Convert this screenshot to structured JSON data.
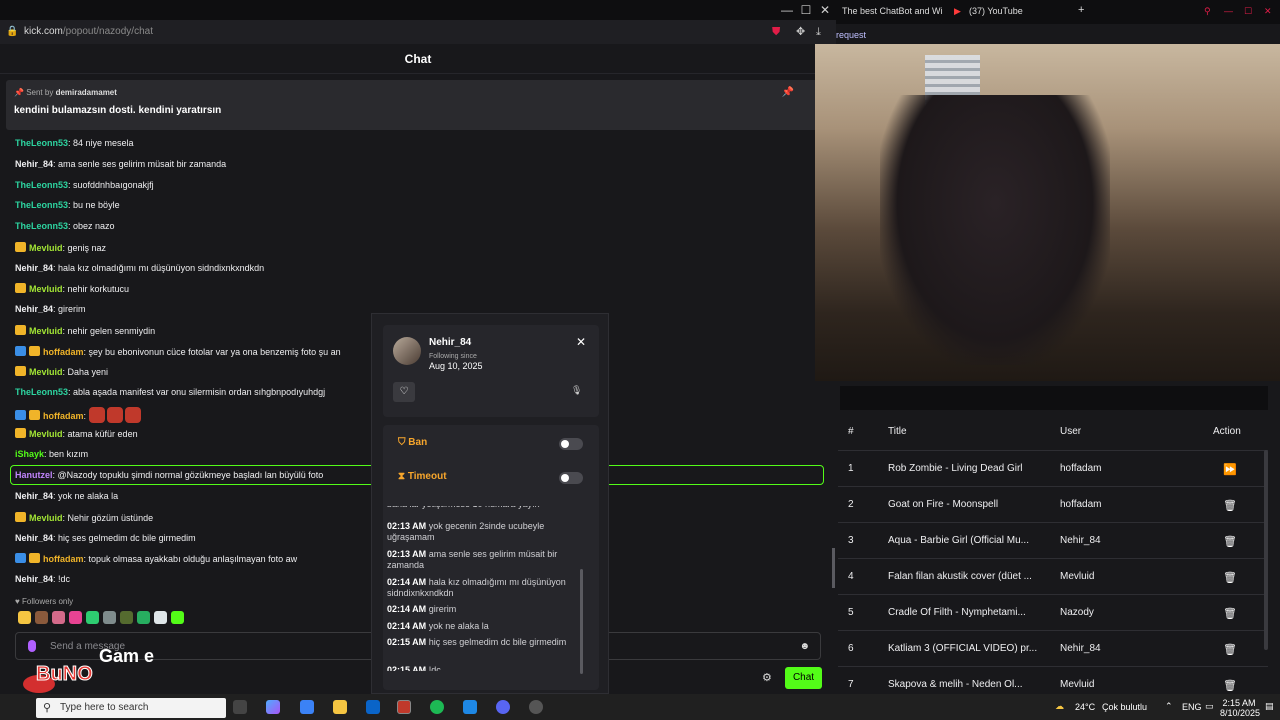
{
  "left_window": {
    "url_host": "kick.com",
    "url_path": "/popout/nazody/chat",
    "chat_title": "Chat",
    "pinned": {
      "sent_by_label": "Sent by",
      "sent_by_user": "demiradamamet",
      "message": "kendini bulamazsın dosti. kendini yaratırsın"
    },
    "messages": [
      {
        "user": "TheLeonn53",
        "color": "#2dd4a0",
        "text": "84 niye mesela",
        "badges": []
      },
      {
        "user": "Nehir_84",
        "color": "#efeff1",
        "text": "ama senle ses gelirim müsait bir zamanda",
        "badges": []
      },
      {
        "user": "TheLeonn53",
        "color": "#2dd4a0",
        "text": "suofddnhbaıgonakjfj",
        "badges": []
      },
      {
        "user": "TheLeonn53",
        "color": "#2dd4a0",
        "text": "bu ne böyle",
        "badges": []
      },
      {
        "user": "TheLeonn53",
        "color": "#2dd4a0",
        "text": "obez nazo",
        "badges": []
      },
      {
        "user": "Mevluid",
        "color": "#a3e635",
        "text": "geniş naz",
        "badges": [
          "crown"
        ]
      },
      {
        "user": "Nehir_84",
        "color": "#efeff1",
        "text": "hala kız olmadığımı mı düşünüyon sidndixnkxndkdn",
        "badges": []
      },
      {
        "user": "Mevluid",
        "color": "#a3e635",
        "text": "nehir korkutucu",
        "badges": [
          "crown"
        ]
      },
      {
        "user": "Nehir_84",
        "color": "#efeff1",
        "text": "girerim",
        "badges": []
      },
      {
        "user": "Mevluid",
        "color": "#a3e635",
        "text": "nehir gelen senmiydin",
        "badges": [
          "crown"
        ]
      },
      {
        "user": "hoffadam",
        "color": "#f0b429",
        "text": "şey bu ebonivonun cüce fotolar var ya ona benzemiş foto şu an",
        "badges": [
          "arrow",
          "crown"
        ]
      },
      {
        "user": "Mevluid",
        "color": "#a3e635",
        "text": "Daha yeni",
        "badges": [
          "crown"
        ]
      },
      {
        "user": "TheLeonn53",
        "color": "#2dd4a0",
        "text": "abla aşada manifest var onu silermisin ordan sıhgbnpodıyuhdgj",
        "badges": []
      },
      {
        "user": "hoffadam",
        "color": "#f0b429",
        "text": "",
        "badges": [
          "arrow",
          "crown"
        ],
        "emotes": 3
      },
      {
        "user": "Mevluid",
        "color": "#a3e635",
        "text": "atama küfür eden",
        "badges": [
          "crown"
        ]
      },
      {
        "user": "iShayk",
        "color": "#53fc18",
        "text": "ben kızım",
        "badges": []
      },
      {
        "user": "Hanutzel",
        "color": "#c084fc",
        "text": "@Nazody topuklu şimdi normal gözükmeye başladı lan büyülü foto",
        "badges": []
      },
      {
        "user": "Nehir_84",
        "color": "#efeff1",
        "text": "yok ne alaka la",
        "badges": []
      },
      {
        "user": "Mevluid",
        "color": "#a3e635",
        "text": "Nehir gözüm üstünde",
        "badges": [
          "crown"
        ]
      },
      {
        "user": "Nehir_84",
        "color": "#efeff1",
        "text": "hiç ses gelmedim dc bile girmedim",
        "badges": []
      },
      {
        "user": "hoffadam",
        "color": "#f0b429",
        "text": "topuk olmasa ayakkabı olduğu anlaşılmayan foto aw",
        "badges": [
          "arrow",
          "crown"
        ]
      },
      {
        "user": "Nehir_84",
        "color": "#efeff1",
        "text": "!dc",
        "badges": []
      }
    ],
    "followers_only": "Followers only",
    "send_placeholder": "Send a message",
    "chat_button": "Chat"
  },
  "user_card": {
    "name": "Nehir_84",
    "following_since_label": "Following since",
    "following_since": "Aug 10, 2025",
    "ban_label": "Ban",
    "timeout_label": "Timeout",
    "history": [
      {
        "time": "",
        "text": "baha lar yetiştirmese 10 numara yayın"
      },
      {
        "time": "02:13 AM",
        "text": "yok gecenin 2sinde ucubeyle uğraşamam"
      },
      {
        "time": "02:13 AM",
        "text": "ama senle ses gelirim müsait bir zamanda"
      },
      {
        "time": "02:14 AM",
        "text": "hala kız olmadığımı mı düşünüyon sidndixnkxndkdn"
      },
      {
        "time": "02:14 AM",
        "text": "girerim"
      },
      {
        "time": "02:14 AM",
        "text": "yok ne alaka la"
      },
      {
        "time": "02:15 AM",
        "text": "hiç ses gelmedim dc bile girmedim"
      },
      {
        "time": "02:15 AM",
        "text": "!dc"
      }
    ]
  },
  "right_window": {
    "tab1": "The best ChatBot and Wi",
    "tab2": "(37) YouTube",
    "addr_text": "request",
    "queue_headers": {
      "num": "#",
      "title": "Title",
      "user": "User",
      "action": "Action"
    },
    "queue": [
      {
        "num": "1",
        "title": "Rob Zombie - Living Dead Girl",
        "user": "hoffadam",
        "action": "⏩"
      },
      {
        "num": "2",
        "title": "Goat on Fire - Moonspell",
        "user": "hoffadam",
        "action": "🗑"
      },
      {
        "num": "3",
        "title": "Aqua - Barbie Girl (Official Mu...",
        "user": "Nehir_84",
        "action": "🗑"
      },
      {
        "num": "4",
        "title": "Falan filan akustik cover (düet ...",
        "user": "Mevluid",
        "action": "🗑"
      },
      {
        "num": "5",
        "title": "Cradle Of Filth - Nymphetami...",
        "user": "Nazody",
        "action": "🗑"
      },
      {
        "num": "6",
        "title": "Katliam 3 (OFFICIAL VIDEO) pr...",
        "user": "Nehir_84",
        "action": "🗑"
      },
      {
        "num": "7",
        "title": "Skapova & melih - Neden Ol...",
        "user": "Mevluid",
        "action": "🗑"
      }
    ]
  },
  "taskbar": {
    "search_placeholder": "Type here to search",
    "weather": "24°C",
    "weather_desc": "Çok bulutlu",
    "lang": "ENG",
    "time": "2:15 AM",
    "date": "8/10/2025"
  },
  "watermark": {
    "text1": "BuNO",
    "text2": "Gam e"
  }
}
